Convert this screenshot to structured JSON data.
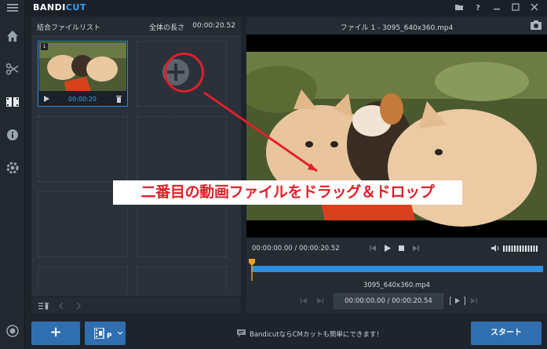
{
  "app": {
    "logo_part1": "BANDI",
    "logo_part2": "CUT"
  },
  "left_panel": {
    "title": "結合ファイルリスト",
    "total_length_label": "全体の長さ",
    "total_length": "00:00:20.52",
    "clips": [
      {
        "index": "1",
        "duration": "00:00:20"
      }
    ]
  },
  "preview": {
    "title": "ファイル 1 - 3095_640x360.mp4",
    "timecode": "00:00:00.00 / 00:00:20.52",
    "filename": "3095_640x360.mp4",
    "range": "00:00:00.00 / 00:00:20.54"
  },
  "bottom_bar": {
    "add_label": "+",
    "promo_text": "BandicutならCMカットも簡単にできます！",
    "start_label": "スタート"
  },
  "annotation": {
    "text": "二番目の動画ファイルをドラッグ＆ドロップ"
  },
  "colors": {
    "accent": "#2f6fb0",
    "timeline": "#2e8fe0",
    "annotation": "#e0202a"
  }
}
